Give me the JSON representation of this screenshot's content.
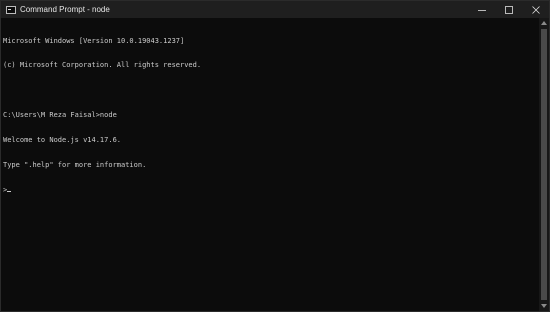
{
  "window": {
    "title": "Command Prompt - node",
    "icon": "console-icon",
    "controls": {
      "minimize": "minimize-icon",
      "maximize": "maximize-icon",
      "close": "close-icon"
    }
  },
  "console": {
    "lines": [
      "Microsoft Windows [Version 10.0.19043.1237]",
      "(c) Microsoft Corporation. All rights reserved.",
      "",
      "C:\\Users\\M Reza Faisal>node",
      "Welcome to Node.js v14.17.6.",
      "Type \".help\" for more information.",
      ">"
    ]
  },
  "colors": {
    "background": "#0c0c0c",
    "text": "#cccccc",
    "titlebar": "#1f1f1f"
  }
}
